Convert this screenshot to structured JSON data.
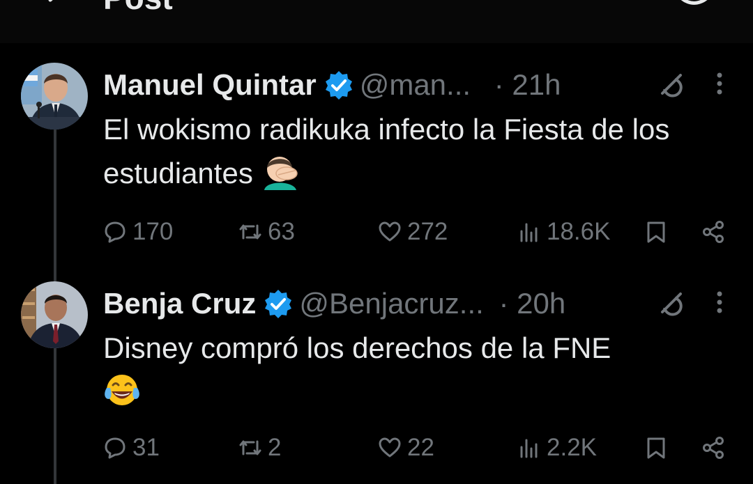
{
  "topbar": {
    "title": "Post"
  },
  "posts": [
    {
      "name": "Manuel Quintar",
      "handle": "@man...",
      "time": "· 21h",
      "text": "El wokismo radikuka infecto la Fiesta de los estudiantes",
      "emoji": "face-palm-emoji",
      "replies": "170",
      "reposts": "63",
      "likes": "272",
      "views": "18.6K"
    },
    {
      "name": "Benja Cruz",
      "handle": "@Benjacruz...",
      "time": "· 20h",
      "text": "Disney compró los derechos de la FNE",
      "emoji": "tears-of-joy-emoji",
      "replies": "31",
      "reposts": "2",
      "likes": "22",
      "views": "2.2K"
    }
  ],
  "colors": {
    "background": "#000000",
    "text": "#e7e9ea",
    "muted": "#71767b",
    "verified": "#1d9bf0"
  }
}
